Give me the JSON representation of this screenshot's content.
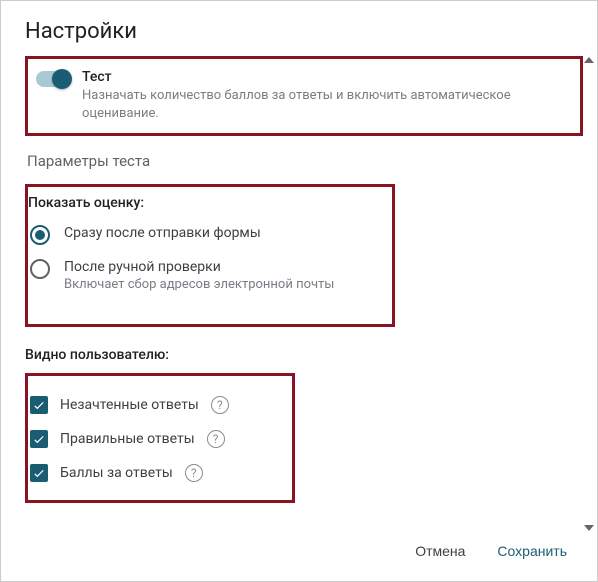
{
  "title": "Настройки",
  "quiz": {
    "label": "Тест",
    "desc": "Назначать количество баллов за ответы и включить автоматическое оценивание."
  },
  "params_heading": "Параметры теста",
  "show_grade": {
    "heading": "Показать оценку:",
    "opt1": {
      "label": "Сразу после отправки формы"
    },
    "opt2": {
      "label": "После ручной проверки",
      "sub": "Включает сбор адресов электронной почты"
    }
  },
  "visible": {
    "heading": "Видно пользователю:",
    "c1": "Незачтенные ответы",
    "c2": "Правильные ответы",
    "c3": "Баллы за ответы"
  },
  "footer": {
    "cancel": "Отмена",
    "save": "Сохранить"
  }
}
